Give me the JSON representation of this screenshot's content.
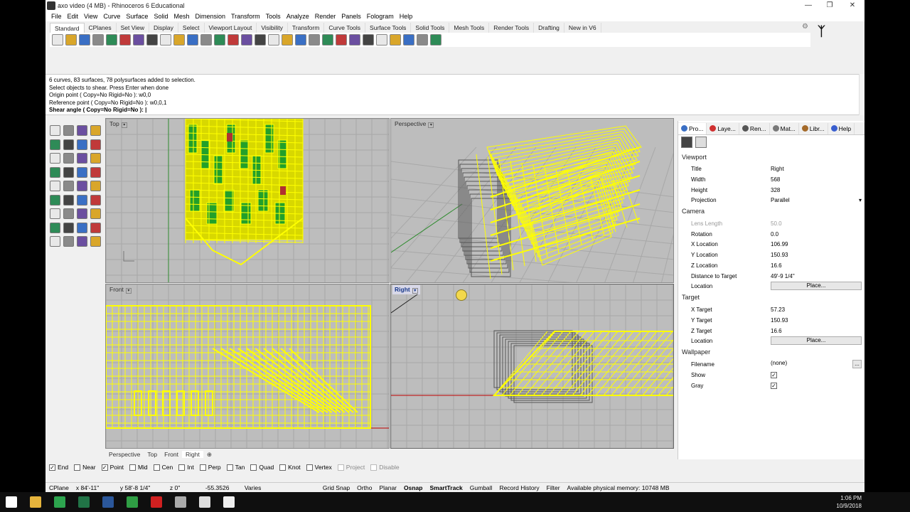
{
  "window": {
    "title": "axo video (4 MB) - Rhinoceros 6 Educational",
    "controls": [
      "minimize",
      "restore",
      "close"
    ]
  },
  "menu": [
    "File",
    "Edit",
    "View",
    "Curve",
    "Surface",
    "Solid",
    "Mesh",
    "Dimension",
    "Transform",
    "Tools",
    "Analyze",
    "Render",
    "Panels",
    "Fologram",
    "Help"
  ],
  "toolbar_tabs": [
    "Standard",
    "CPlanes",
    "Set View",
    "Display",
    "Select",
    "Viewport Layout",
    "Visibility",
    "Transform",
    "Curve Tools",
    "Surface Tools",
    "Solid Tools",
    "Mesh Tools",
    "Render Tools",
    "Drafting",
    "New in V6"
  ],
  "toolbar_icons": [
    "new-file",
    "open-file",
    "save-file",
    "print",
    "import",
    "cut",
    "copy",
    "paste",
    "undo",
    "pan",
    "zoom-window",
    "zoom-dynamic",
    "zoom-extents",
    "zoom-selected",
    "rotate-view",
    "four-view",
    "cplane",
    "cplane-options",
    "grid-snap",
    "lock",
    "display-mode",
    "render-sphere",
    "shaded-sphere",
    "rendered-sphere",
    "properties",
    "options",
    "lighting",
    "gumball",
    "help"
  ],
  "command_history": [
    "6 curves, 83 surfaces, 78 polysurfaces added to selection.",
    "Select objects to shear. Press Enter when done",
    "Origin point ( Copy=No  Rigid=No ): w0,0",
    "Reference point ( Copy=No  Rigid=No ): w0,0,1"
  ],
  "command_prompt": "Shear angle ( Copy=No  Rigid=No ): |",
  "left_tools_count": 36,
  "viewports": [
    {
      "name": "Top"
    },
    {
      "name": "Perspective"
    },
    {
      "name": "Front"
    },
    {
      "name": "Right"
    }
  ],
  "viewport_tabs": [
    "Perspective",
    "Top",
    "Front",
    "Right",
    "⊕"
  ],
  "osnaps": [
    {
      "label": "End",
      "checked": true
    },
    {
      "label": "Near",
      "checked": false
    },
    {
      "label": "Point",
      "checked": true
    },
    {
      "label": "Mid",
      "checked": false
    },
    {
      "label": "Cen",
      "checked": false
    },
    {
      "label": "Int",
      "checked": false
    },
    {
      "label": "Perp",
      "checked": false
    },
    {
      "label": "Tan",
      "checked": false
    },
    {
      "label": "Quad",
      "checked": false
    },
    {
      "label": "Knot",
      "checked": false
    },
    {
      "label": "Vertex",
      "checked": false
    },
    {
      "label": "Project",
      "checked": false,
      "disabled": true
    },
    {
      "label": "Disable",
      "checked": false,
      "disabled": true
    }
  ],
  "status_bar": {
    "cplane": "CPlane",
    "x": "x 84'-11\"",
    "y": "y 58'-8 1/4\"",
    "z": "z 0\"",
    "dist": "-55.3526",
    "layer": "Varies",
    "toggles": [
      "Grid Snap",
      "Ortho",
      "Planar",
      "Osnap",
      "SmartTrack",
      "Gumball",
      "Record History",
      "Filter"
    ],
    "bold_toggles": [
      "Osnap",
      "SmartTrack"
    ],
    "memory": "Available physical memory: 10748 MB"
  },
  "panel_tabs": [
    "Pro...",
    "Laye...",
    "Ren...",
    "Mat...",
    "Libr...",
    "Help"
  ],
  "properties": {
    "viewport_header": "Viewport",
    "title_label": "Title",
    "title_value": "Right",
    "width_label": "Width",
    "width_value": "568",
    "height_label": "Height",
    "height_value": "328",
    "projection_label": "Projection",
    "projection_value": "Parallel",
    "camera_header": "Camera",
    "lens_label": "Lens Length",
    "lens_value": "50.0",
    "rotation_label": "Rotation",
    "rotation_value": "0.0",
    "xloc_label": "X Location",
    "xloc_value": "106.99",
    "yloc_label": "Y Location",
    "yloc_value": "150.93",
    "zloc_label": "Z Location",
    "zloc_value": "16.6",
    "dist_label": "Distance to Target",
    "dist_value": "49'-9 1/4\"",
    "location_label": "Location",
    "place_label": "Place...",
    "target_header": "Target",
    "xt_label": "X Target",
    "xt_value": "57.23",
    "yt_label": "Y Target",
    "yt_value": "150.93",
    "zt_label": "Z Target",
    "zt_value": "16.6",
    "tlocation_label": "Location",
    "tplace_label": "Place...",
    "wallpaper_header": "Wallpaper",
    "filename_label": "Filename",
    "filename_value": "(none)",
    "browse_label": "...",
    "show_label": "Show",
    "show_checked": true,
    "gray_label": "Gray",
    "gray_checked": true
  },
  "taskbar": {
    "time": "1:06 PM",
    "date": "10/9/2018",
    "apps": [
      "start",
      "file-explorer",
      "chrome",
      "excel",
      "word",
      "camtasia",
      "acrobat",
      "notepad",
      "rhino",
      "camtasia-recorder"
    ]
  },
  "colors": {
    "wire": "#ffff00",
    "viewport_bg": "#bdbdbd",
    "grid": "#a8a8a8",
    "active_header": "#1a3a8a",
    "axis_x": "#c00000",
    "axis_y": "#009000"
  }
}
